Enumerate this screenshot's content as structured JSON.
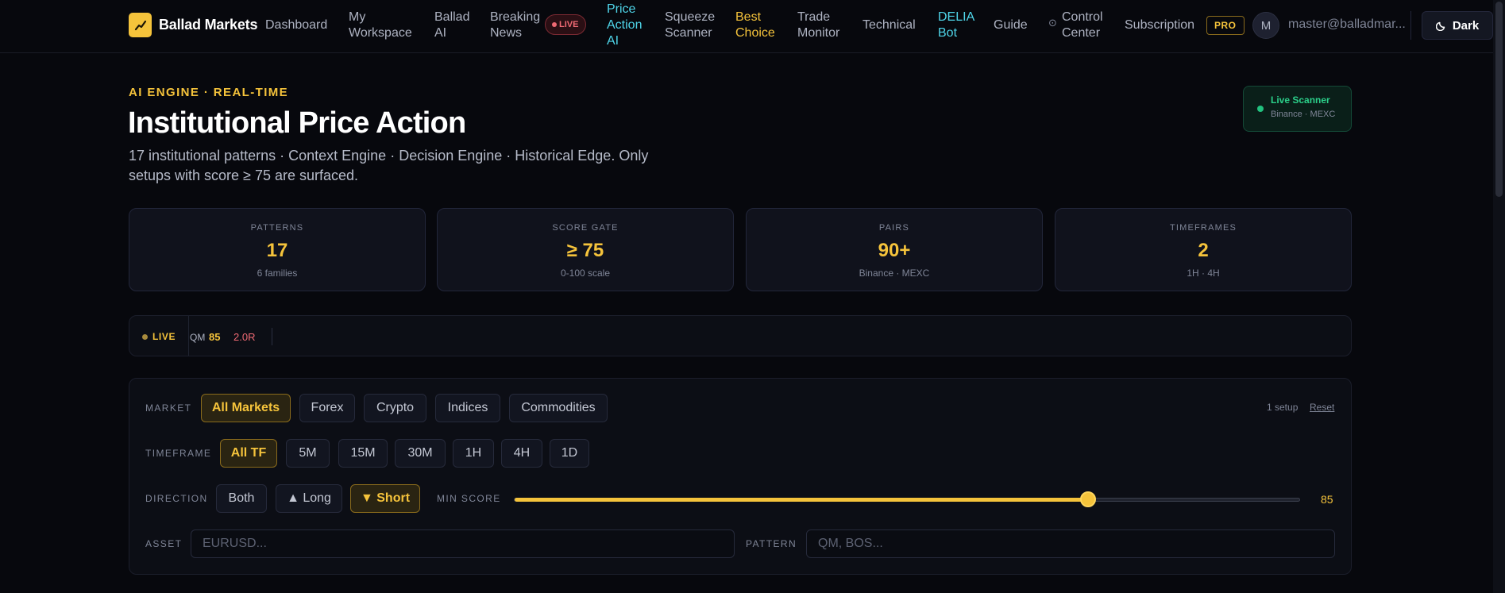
{
  "brand": {
    "name": "Ballad Markets"
  },
  "nav": {
    "items": [
      {
        "label": "Dashboard"
      },
      {
        "label": "My Workspace"
      },
      {
        "label": "Ballad AI"
      },
      {
        "label": "Breaking News"
      },
      {
        "label": "Price Action AI"
      },
      {
        "label": "Squeeze Scanner"
      },
      {
        "label": "Best Choice"
      },
      {
        "label": "Trade Monitor"
      },
      {
        "label": "Technical"
      },
      {
        "label": "DELIA Bot"
      },
      {
        "label": "Guide"
      },
      {
        "label": "Control Center"
      },
      {
        "label": "Subscription"
      }
    ],
    "live_badge": "LIVE",
    "pro_badge": "PRO",
    "avatar_initial": "M",
    "email": "master@balladmar...",
    "theme_label": "Dark"
  },
  "hero": {
    "eyebrow": "AI ENGINE · REAL-TIME",
    "title": "Institutional Price Action",
    "subtitle": "17 institutional patterns · Context Engine · Decision Engine · Historical Edge. Only setups with score ≥ 75 are surfaced.",
    "scanner_title": "Live Scanner",
    "scanner_sub": "Binance · MEXC"
  },
  "stats": [
    {
      "label": "PATTERNS",
      "value": "17",
      "sub": "6 families"
    },
    {
      "label": "SCORE GATE",
      "value": "≥ 75",
      "sub": "0-100 scale"
    },
    {
      "label": "PAIRS",
      "value": "90+",
      "sub": "Binance · MEXC"
    },
    {
      "label": "TIMEFRAMES",
      "value": "2",
      "sub": "1H · 4H"
    }
  ],
  "ticker": {
    "badge": "LIVE",
    "pattern": "QM",
    "score": "85",
    "rr": "2.0R"
  },
  "filters": {
    "market_label": "MARKET",
    "markets": [
      "All Markets",
      "Forex",
      "Crypto",
      "Indices",
      "Commodities"
    ],
    "setup_count": "1 setup",
    "reset_label": "Reset",
    "timeframe_label": "TIMEFRAME",
    "timeframes": [
      "All TF",
      "5M",
      "15M",
      "30M",
      "1H",
      "4H",
      "1D"
    ],
    "direction_label": "DIRECTION",
    "directions": [
      "Both",
      "▲ Long",
      "▼ Short"
    ],
    "min_score_label": "MIN SCORE",
    "min_score": 85,
    "min_score_text": "85",
    "asset_label": "ASSET",
    "asset_placeholder": "EURUSD...",
    "pattern_label": "PATTERN",
    "pattern_placeholder": "QM, BOS..."
  },
  "colors": {
    "accent": "#f5c33b",
    "cyan": "#4fd6ea",
    "green": "#22c27f",
    "red": "#f06a74",
    "background": "#07080d"
  }
}
